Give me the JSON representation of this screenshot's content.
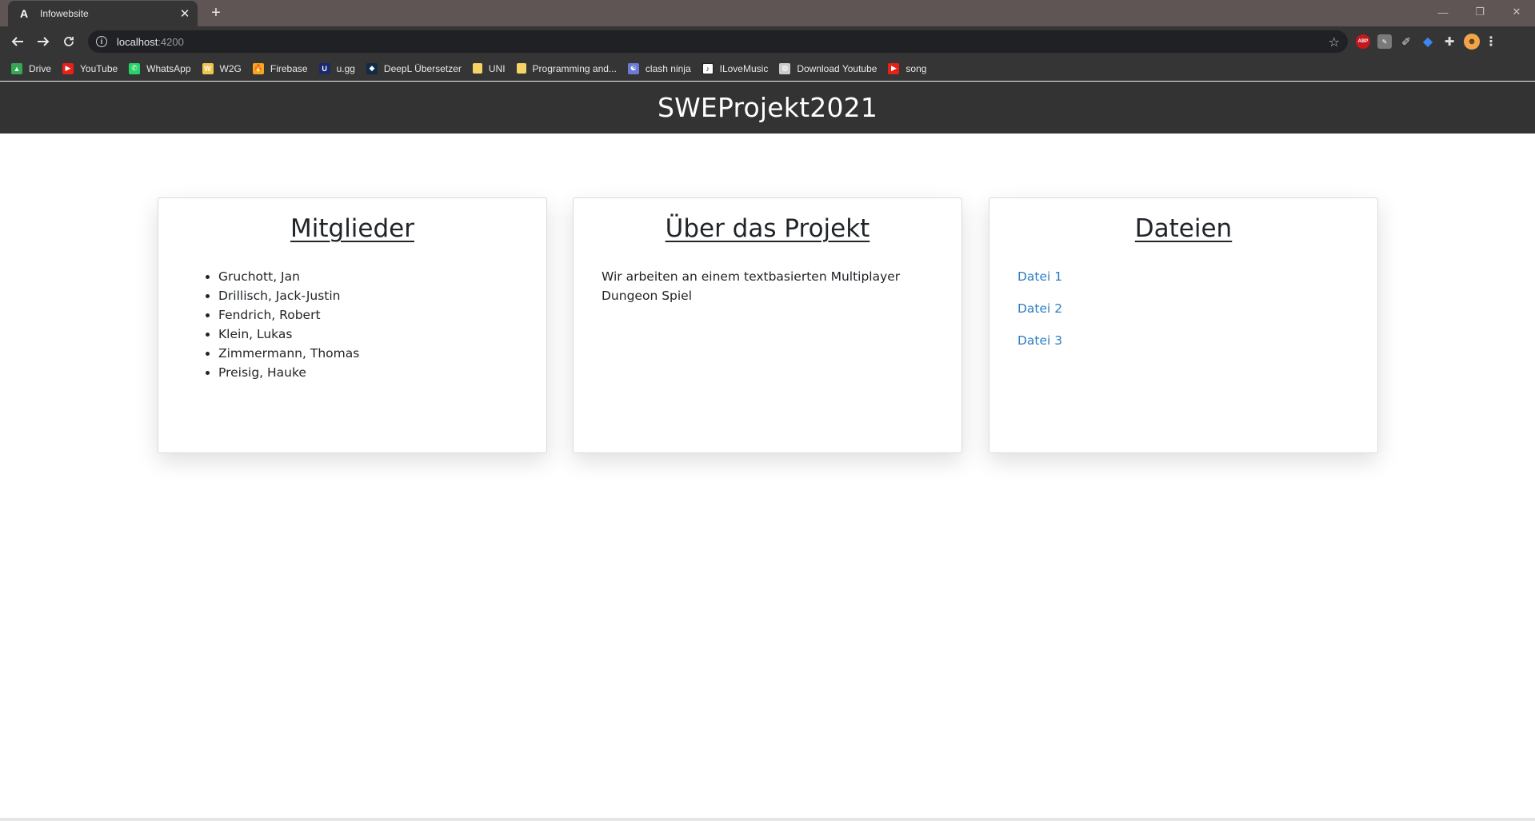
{
  "browser": {
    "tab_title": "Infowebsite",
    "tab_favicon": "A",
    "new_tab_symbol": "+",
    "url_host": "localhost",
    "url_port": ":4200",
    "extensions": [
      "ABP",
      "",
      "",
      "",
      "",
      "",
      ""
    ],
    "bookmarks": [
      {
        "label": "Drive",
        "icon": "drive-icon",
        "color": "#34a853",
        "glyph": "▲"
      },
      {
        "label": "YouTube",
        "icon": "youtube-icon",
        "color": "#e62117",
        "glyph": "▶"
      },
      {
        "label": "WhatsApp",
        "icon": "whatsapp-icon",
        "color": "#25d366",
        "glyph": "✆"
      },
      {
        "label": "W2G",
        "icon": "w2g-icon",
        "color": "#f3c44b",
        "glyph": "W"
      },
      {
        "label": "Firebase",
        "icon": "firebase-icon",
        "color": "#f5a623",
        "glyph": "🔥"
      },
      {
        "label": "u.gg",
        "icon": "ugg-icon",
        "color": "#1a2a6b",
        "glyph": "U"
      },
      {
        "label": "DeepL Übersetzer",
        "icon": "deepl-icon",
        "color": "#0f2b46",
        "glyph": "◆"
      },
      {
        "label": "UNI",
        "icon": "folder-icon",
        "color": "#f6d365",
        "glyph": ""
      },
      {
        "label": "Programming and...",
        "icon": "folder-icon",
        "color": "#f6d365",
        "glyph": ""
      },
      {
        "label": "clash ninja",
        "icon": "clash-ninja-icon",
        "color": "#6a7bd6",
        "glyph": "☯"
      },
      {
        "label": "ILoveMusic",
        "icon": "ilovemusic-icon",
        "color": "#ffffff",
        "glyph": "♪"
      },
      {
        "label": "Download Youtube",
        "icon": "globe-icon",
        "color": "#cccccc",
        "glyph": "◍"
      },
      {
        "label": "song",
        "icon": "youtube-icon",
        "color": "#e62117",
        "glyph": "▶"
      }
    ]
  },
  "header": {
    "title": "SWEProjekt2021"
  },
  "cards": {
    "members": {
      "title": "Mitglieder",
      "items": [
        "Gruchott, Jan",
        "Drillisch, Jack-Justin",
        "Fendrich, Robert",
        "Klein, Lukas",
        "Zimmermann, Thomas",
        "Preisig, Hauke"
      ]
    },
    "about": {
      "title": "Über das Projekt",
      "text": "Wir arbeiten an einem textbasierten Multiplayer Dungeon Spiel"
    },
    "files": {
      "title": "Dateien",
      "links": [
        "Datei 1",
        "Datei 2",
        "Datei 3"
      ]
    }
  },
  "colors": {
    "header_bg": "#333333",
    "link": "#2c7cc2",
    "browser_chrome": "#353535"
  }
}
